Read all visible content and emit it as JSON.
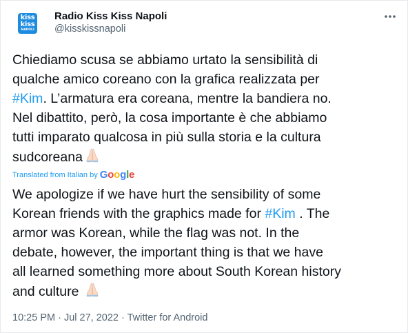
{
  "account": {
    "display_name": "Radio Kiss Kiss Napoli",
    "handle": "@kisskissnapoli",
    "logo_line1": "kiss",
    "logo_line2": "kiss",
    "logo_line3": "NAPOLI",
    "logo_color": "#1c8be0"
  },
  "header": {
    "more_icon": "more-horizontal-icon"
  },
  "original": {
    "lines": [
      {
        "text": "Chiediamo scusa se abbiamo urtato la sensibilità di"
      },
      {
        "text": "qualche amico coreano con la grafica realizzata per"
      },
      {
        "hashtag": "#Kim",
        "text": ". L’armatura era coreana, mentre la bandiera no."
      },
      {
        "text": "Nel dibattito, però, la cosa importante è che abbiamo"
      },
      {
        "text": "tutti imparato qualcosa in più sulla storia e la cultura"
      },
      {
        "text": "sudcoreana"
      }
    ],
    "emoji": "folded-hands-icon"
  },
  "translation": {
    "label": "Translated from Italian by",
    "provider": "Google",
    "lines": [
      {
        "text": "We apologize if we have hurt the sensibility of some"
      },
      {
        "text_before": "Korean friends with the graphics made for ",
        "hashtag": "#Kim",
        "text_after": " . The"
      },
      {
        "text": "armor was Korean, while the flag was not. In the"
      },
      {
        "text": "debate, however, the important thing is that we have"
      },
      {
        "text": "all learned something more about South Korean history"
      },
      {
        "text": "and culture "
      }
    ],
    "emoji": "folded-hands-icon"
  },
  "meta": {
    "time": "10:25 PM",
    "separator": " · ",
    "date": "Jul 27, 2022",
    "source": "Twitter for Android"
  },
  "colors": {
    "accent": "#1d9bf0",
    "text": "#0f1419",
    "secondary": "#536471"
  }
}
